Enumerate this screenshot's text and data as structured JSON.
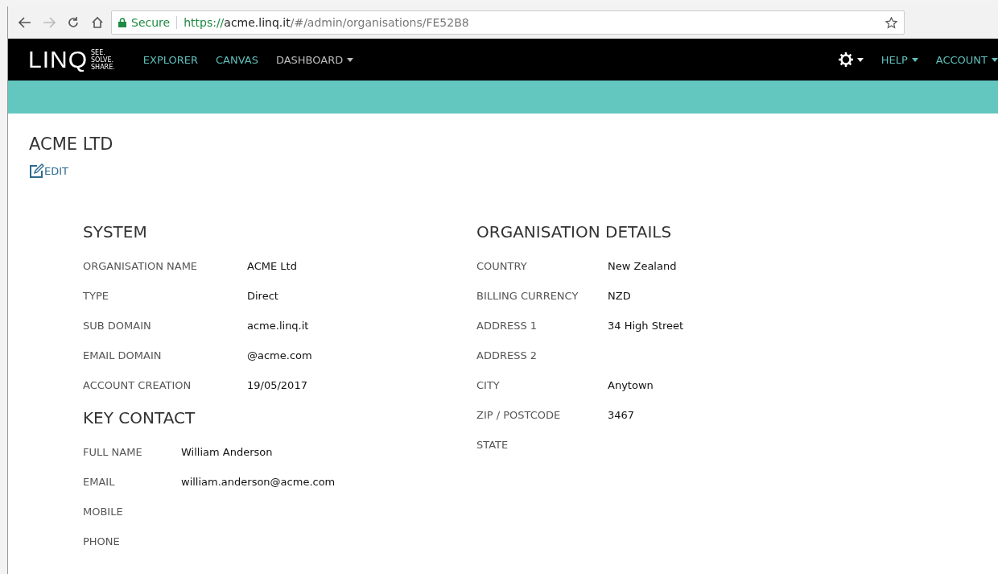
{
  "browser": {
    "secure_label": "Secure",
    "url_scheme": "https://",
    "url_host": "acme.linq.it",
    "url_path": "/#/admin/organisations/FE52B8"
  },
  "navbar": {
    "logo": "LINQ",
    "tagline": [
      "SEE.",
      "SOLVE.",
      "SHARE."
    ],
    "left_items": [
      {
        "label": "EXPLORER",
        "dropdown": false,
        "color": "#5fbfbb"
      },
      {
        "label": "CANVAS",
        "dropdown": false,
        "color": "#5fbfbb"
      },
      {
        "label": "DASHBOARD",
        "dropdown": true,
        "color": "#bdbdbd"
      }
    ],
    "right_items": [
      {
        "label": "HELP",
        "dropdown": true,
        "color": "#5fbfbb"
      },
      {
        "label": "ACCOUNT",
        "dropdown": true,
        "color": "#5fbfbb"
      }
    ]
  },
  "page": {
    "title": "ACME LTD",
    "edit_label": "EDIT"
  },
  "columns": [
    {
      "sections": [
        {
          "title": "SYSTEM",
          "fields": [
            {
              "label": "ORGANISATION NAME",
              "value": "ACME Ltd"
            },
            {
              "label": "TYPE",
              "value": "Direct"
            },
            {
              "label": "SUB DOMAIN",
              "value": "acme.linq.it"
            },
            {
              "label": "EMAIL DOMAIN",
              "value": "@acme.com"
            },
            {
              "label": "ACCOUNT CREATION",
              "value": "19/05/2017"
            }
          ]
        },
        {
          "title": "KEY CONTACT",
          "fields": [
            {
              "label": "FULL NAME",
              "value": "William Anderson"
            },
            {
              "label": "EMAIL",
              "value": "william.anderson@acme.com"
            },
            {
              "label": "MOBILE"
            },
            {
              "label": "PHONE"
            }
          ]
        }
      ]
    },
    {
      "sections": [
        {
          "title": "ORGANISATION DETAILS",
          "fields": [
            {
              "label": "COUNTRY",
              "value": "New Zealand"
            },
            {
              "label": "BILLING CURRENCY",
              "value": "NZD"
            },
            {
              "label": "ADDRESS 1",
              "value": "34 High Street"
            },
            {
              "label": "ADDRESS 2"
            },
            {
              "label": "CITY",
              "value": "Anytown"
            },
            {
              "label": "ZIP / POSTCODE",
              "value": "3467"
            },
            {
              "label": "STATE"
            }
          ]
        }
      ]
    }
  ]
}
